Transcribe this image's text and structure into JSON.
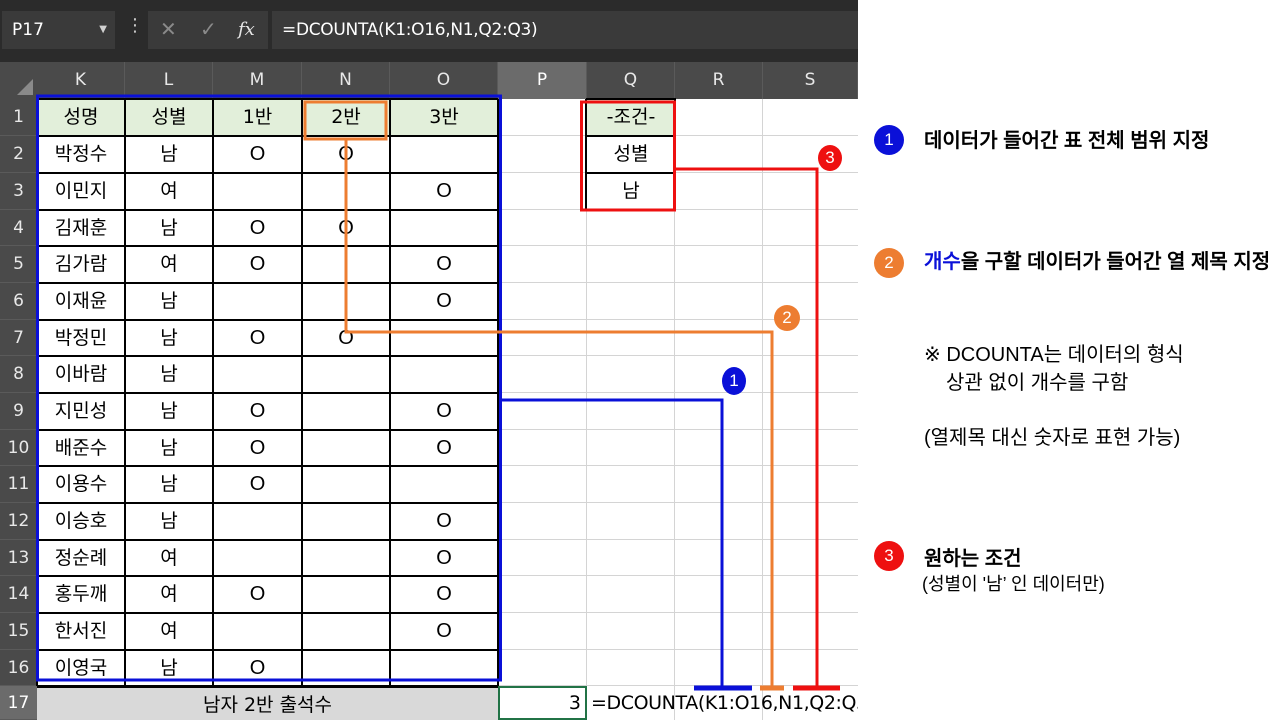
{
  "formula_bar": {
    "name_box": "P17",
    "more_icon": "vertical-ellipsis-icon",
    "cancel_icon": "cancel-x-icon",
    "enter_icon": "checkmark-icon",
    "fx_label": "fx",
    "formula": "=DCOUNTA(K1:O16,N1,Q2:Q3)"
  },
  "columns": [
    "K",
    "L",
    "M",
    "N",
    "O",
    "P",
    "Q",
    "R",
    "S"
  ],
  "selected_column": "P",
  "rows": [
    "1",
    "2",
    "3",
    "4",
    "5",
    "6",
    "7",
    "8",
    "9",
    "10",
    "11",
    "12",
    "13",
    "14",
    "15",
    "16",
    "17"
  ],
  "selected_row": "17",
  "table": {
    "headers": [
      "성명",
      "성별",
      "1반",
      "2반",
      "3반"
    ],
    "records": [
      [
        "박정수",
        "남",
        "O",
        "O",
        ""
      ],
      [
        "이민지",
        "여",
        "",
        "",
        "O"
      ],
      [
        "김재훈",
        "남",
        "O",
        "O",
        ""
      ],
      [
        "김가람",
        "여",
        "O",
        "",
        "O"
      ],
      [
        "이재윤",
        "남",
        "",
        "",
        "O"
      ],
      [
        "박정민",
        "남",
        "O",
        "O",
        ""
      ],
      [
        "이바람",
        "남",
        "",
        "",
        ""
      ],
      [
        "지민성",
        "남",
        "O",
        "",
        "O"
      ],
      [
        "배준수",
        "남",
        "O",
        "",
        "O"
      ],
      [
        "이용수",
        "남",
        "O",
        "",
        ""
      ],
      [
        "이승호",
        "남",
        "",
        "",
        "O"
      ],
      [
        "정순례",
        "여",
        "",
        "",
        "O"
      ],
      [
        "홍두깨",
        "여",
        "O",
        "",
        "O"
      ],
      [
        "한서진",
        "여",
        "",
        "",
        "O"
      ],
      [
        "이영국",
        "남",
        "O",
        "",
        ""
      ]
    ]
  },
  "criteria": {
    "title": "-조건-",
    "field": "성별",
    "value": "남"
  },
  "summary": {
    "label": "남자 2반 출석수",
    "result": "3",
    "formula_text": "=DCOUNTA(K1:O16,N1,Q2:Q3)"
  },
  "colors": {
    "range": "#0a10d8",
    "field": "#ed7d31",
    "criteria": "#ee1010",
    "header_bg": "#e2efda",
    "summary_bg": "#d9d9d9"
  },
  "annotations": {
    "badge1": "1",
    "badge2": "2",
    "badge3": "3",
    "note1": "데이터가 들어간 표 전체 범위 지정",
    "note2_blue": "개수",
    "note2_rest": "을 구할 데이터가 들어간 열 제목 지정",
    "note2_tip_line1": "※ DCOUNTA는 데이터의 형식",
    "note2_tip_line2": "상관 없이 개수를 구함",
    "note2_alt": "(열제목 대신 숫자로 표현 가능)",
    "note3_title": "원하는 조건",
    "note3_sub": "(성별이 '남’ 인 데이터만)"
  }
}
